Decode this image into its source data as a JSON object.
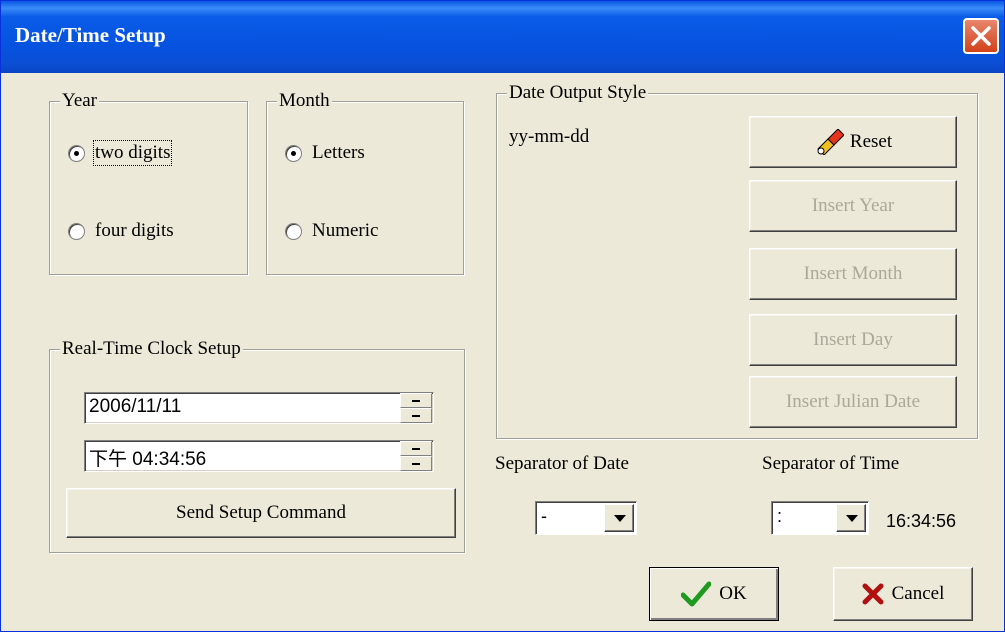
{
  "window": {
    "title": "Date/Time Setup"
  },
  "year_group": {
    "legend": "Year",
    "options": [
      "two digits",
      "four digits"
    ],
    "selected": "two digits"
  },
  "month_group": {
    "legend": "Month",
    "options": [
      "Letters",
      "Numeric"
    ],
    "selected": "Letters"
  },
  "rtc_group": {
    "legend": "Real-Time Clock Setup",
    "date_value": "2006/11/11",
    "time_value": "下午 04:34:56",
    "send_label": "Send Setup Command"
  },
  "output_group": {
    "legend": "Date Output Style",
    "format": "yy-mm-dd",
    "reset_label": "Reset",
    "insert_year_label": "Insert Year",
    "insert_month_label": "Insert Month",
    "insert_day_label": "Insert Day",
    "insert_julian_label": "Insert Julian Date"
  },
  "separators": {
    "date_label": "Separator of Date",
    "date_value": "-",
    "time_label": "Separator of Time",
    "time_value": ":",
    "time_preview": "16:34:56"
  },
  "footer": {
    "ok_label": "OK",
    "cancel_label": "Cancel"
  },
  "colors": {
    "titlebar": "#0a5ce8",
    "face": "#ece9d8",
    "disabled_text": "#aca899",
    "ok_check": "#1e9a1e",
    "cancel_x": "#b01010"
  },
  "icons": {
    "close": "close-icon",
    "reset": "eraser-icon",
    "ok": "checkmark-icon",
    "cancel": "x-icon"
  }
}
